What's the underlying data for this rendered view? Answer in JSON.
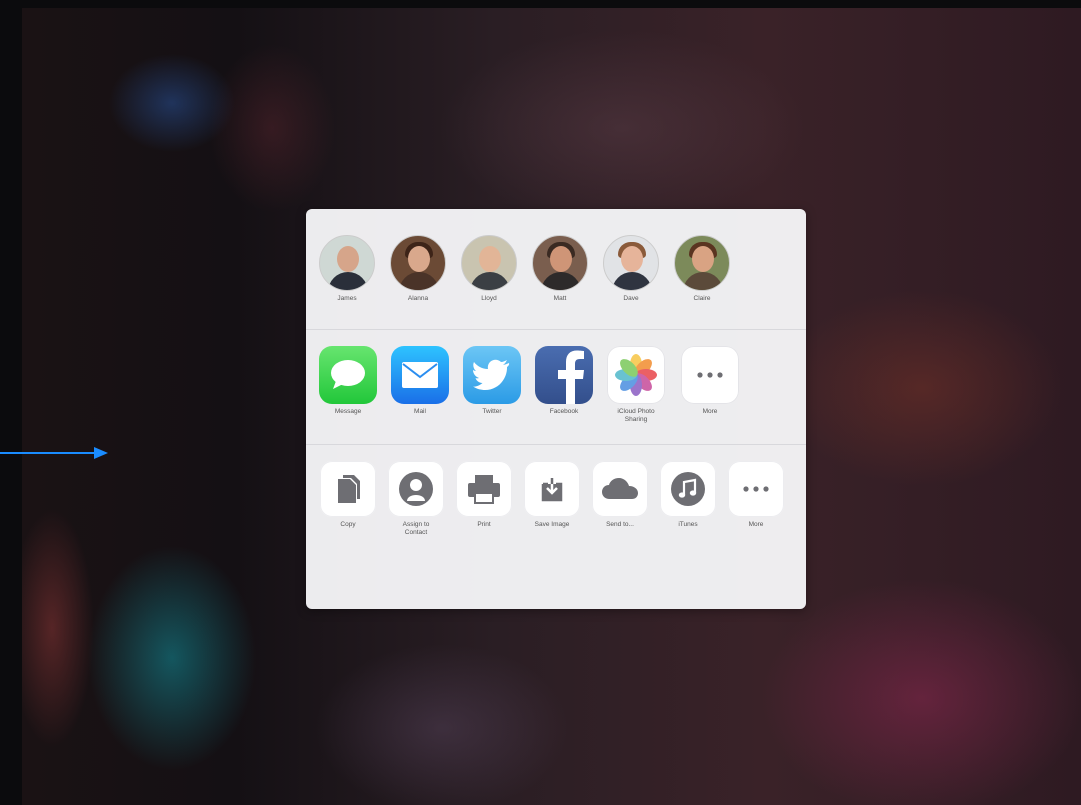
{
  "people": [
    {
      "name": "James"
    },
    {
      "name": "Alanna"
    },
    {
      "name": "Lloyd"
    },
    {
      "name": "Matt"
    },
    {
      "name": "Dave"
    },
    {
      "name": "Claire"
    }
  ],
  "apps": [
    {
      "label": "Message",
      "icon": "message-icon"
    },
    {
      "label": "Mail",
      "icon": "mail-icon"
    },
    {
      "label": "Twitter",
      "icon": "twitter-icon"
    },
    {
      "label": "Facebook",
      "icon": "facebook-icon"
    },
    {
      "label": "iCloud Photo Sharing",
      "icon": "photos-icon"
    },
    {
      "label": "More",
      "icon": "more-icon"
    }
  ],
  "actions": [
    {
      "label": "Copy",
      "icon": "copy-icon"
    },
    {
      "label": "Assign to Contact",
      "icon": "contact-icon"
    },
    {
      "label": "Print",
      "icon": "print-icon"
    },
    {
      "label": "Save Image",
      "icon": "save-image-icon"
    },
    {
      "label": "Send to...",
      "icon": "cloud-icon"
    },
    {
      "label": "iTunes",
      "icon": "music-note-icon"
    },
    {
      "label": "More",
      "icon": "more-icon"
    }
  ],
  "colors": {
    "arrow": "#1a8cff",
    "message": "#4cd964",
    "mail": "#1d8cf5",
    "twitter": "#55acee",
    "facebook": "#3b5998",
    "action_glyph": "#6e6e73"
  }
}
